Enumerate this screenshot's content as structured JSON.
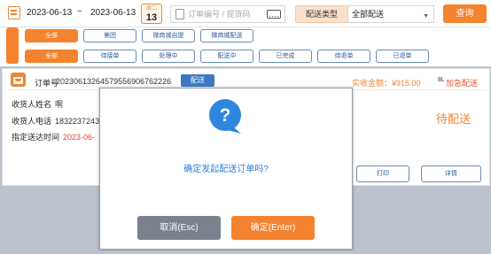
{
  "filter": {
    "start_date": "2023-06-13",
    "range_sep": "~",
    "end_date": "2023-06-13",
    "weekday": "周二",
    "day": "13",
    "search_placeholder": "订单编号 / 提货码",
    "type_label": "配送类型",
    "type_value": "全部配送",
    "query_label": "查询"
  },
  "tabs_row1": [
    "全部",
    "美团",
    "微商城自提",
    "微商城配送"
  ],
  "tabs_row2": [
    "全部",
    "待接单",
    "处理中",
    "配送中",
    "已完成",
    "待退单",
    "已退单"
  ],
  "order": {
    "no_label": "订单号",
    "no": "20230613264579556906762226",
    "badge": "配送",
    "amount": "实收金额：¥915.00",
    "urgent_icon": "8L",
    "urgent": "加急配送",
    "name_label": "收货人姓名",
    "name": "啊",
    "phone_label": "收货人电话",
    "phone": "1832237243",
    "time_label": "指定送达时间",
    "time": "2023-06-",
    "status": "待配送",
    "btn_print": "打印",
    "btn_detail": "详情"
  },
  "dialog": {
    "icon": "question-icon",
    "message": "确定发起配送订单吗?",
    "cancel_label": "取消(Esc)",
    "ok_label": "确定(Enter)"
  },
  "colors": {
    "accent": "#f3832e",
    "tab_border": "#6a8ab5",
    "dialog_text": "#2e7fd0",
    "badge_blue": "#3c78c2"
  }
}
